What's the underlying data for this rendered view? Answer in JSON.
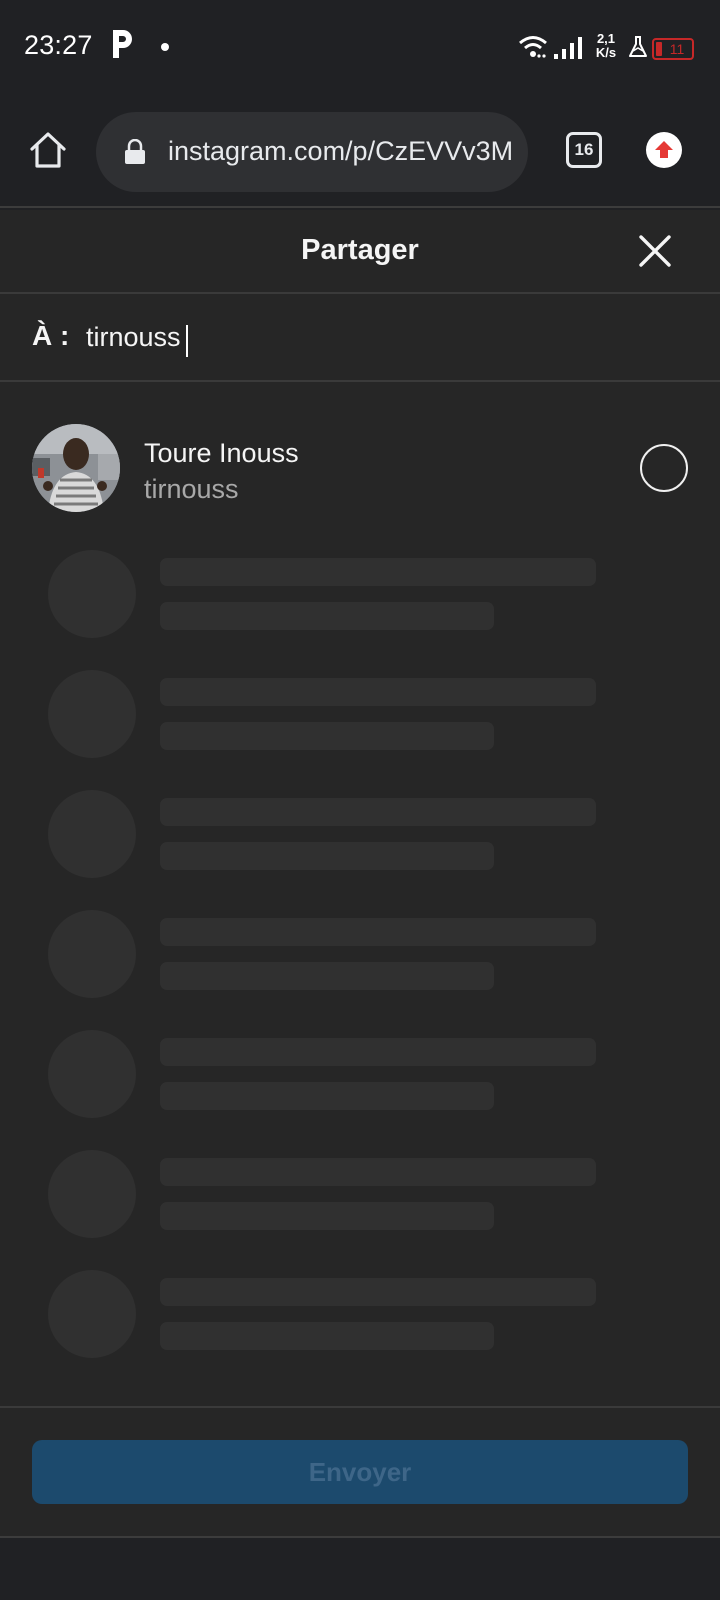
{
  "status_bar": {
    "time": "23:27",
    "net_speed_value": "2,1",
    "net_speed_unit": "K/s",
    "battery_level": "11",
    "battery_color": "#c62828",
    "icons": [
      "p-app-icon",
      "dot-icon",
      "wifi-icon",
      "signal-icon",
      "flask-icon",
      "battery-icon"
    ]
  },
  "browser": {
    "url": "instagram.com/p/CzEVVv3M",
    "tab_count": "16",
    "icons": [
      "home-icon",
      "lock-icon",
      "tabs-icon",
      "update-icon"
    ]
  },
  "share": {
    "title": "Partager",
    "to_label": "À :",
    "search_value": "tirnouss",
    "results": [
      {
        "name": "Toure Inouss",
        "username": "tirnouss",
        "selected": false
      }
    ],
    "send_label": "Envoyer",
    "send_color": "#1c4a6d"
  }
}
